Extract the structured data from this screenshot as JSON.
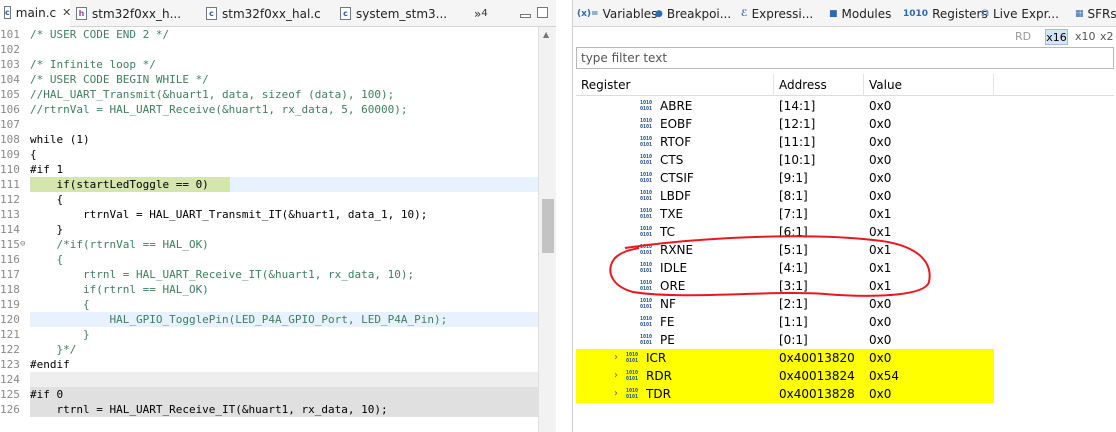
{
  "editor": {
    "tabs": [
      {
        "label": "main.c",
        "close": "✕"
      },
      {
        "label": "stm32f0xx_h..."
      },
      {
        "label": "stm32f0xx_hal.c"
      },
      {
        "label": "system_stm3..."
      }
    ],
    "overflow_label": "»",
    "overflow_count": "4",
    "lines": [
      {
        "n": "101",
        "t": "/* USER CODE END 2 */",
        "c": true
      },
      {
        "n": "102",
        "t": ""
      },
      {
        "n": "103",
        "t": "/* Infinite loop */",
        "c": true
      },
      {
        "n": "104",
        "t": "/* USER CODE BEGIN WHILE */",
        "c": true
      },
      {
        "n": "105",
        "t": "//HAL_UART_Transmit(&huart1, data, sizeof (data), 100);",
        "c": true
      },
      {
        "n": "106",
        "t": "//rtrnVal = HAL_UART_Receive(&huart1, rx_data, 5, 60000);",
        "c": true
      },
      {
        "n": "107",
        "t": ""
      },
      {
        "n": "108",
        "t": "while (1)"
      },
      {
        "n": "109",
        "t": "{"
      },
      {
        "n": "110",
        "t": "#if 1"
      },
      {
        "n": "111",
        "t": "    if(startLedToggle == 0)"
      },
      {
        "n": "112",
        "t": "    {"
      },
      {
        "n": "113",
        "t": "        rtrnVal = HAL_UART_Transmit_IT(&huart1, data_1, 10);"
      },
      {
        "n": "114",
        "t": "    }"
      },
      {
        "n": "115",
        "t": "    /*if(rtrnVal == HAL_OK)",
        "c": true,
        "fold": "⊖"
      },
      {
        "n": "116",
        "t": "    {",
        "c": true
      },
      {
        "n": "117",
        "t": "        rtrnl = HAL_UART_Receive_IT(&huart1, rx_data, 10);",
        "c": true
      },
      {
        "n": "118",
        "t": "        if(rtrnl == HAL_OK)",
        "c": true
      },
      {
        "n": "119",
        "t": "        {",
        "c": true
      },
      {
        "n": "120",
        "t": "            HAL_GPIO_TogglePin(LED_P4A_GPIO_Port, LED_P4A_Pin);",
        "c": true
      },
      {
        "n": "121",
        "t": "        }",
        "c": true
      },
      {
        "n": "122",
        "t": "    }*/",
        "c": true
      },
      {
        "n": "123",
        "t": "#endif"
      },
      {
        "n": "124",
        "t": ""
      },
      {
        "n": "125",
        "t": "#if 0"
      },
      {
        "n": "126",
        "t": "    rtrnl = HAL_UART_Receive_IT(&huart1, rx_data, 10);"
      }
    ]
  },
  "panel": {
    "tabs": [
      {
        "icon": "(x)=",
        "label": "Variables"
      },
      {
        "icon": "●",
        "label": "Breakpoi..."
      },
      {
        "icon": "ℰ",
        "label": "Expressi..."
      },
      {
        "icon": "■",
        "label": "Modules"
      },
      {
        "icon": "1010",
        "label": "Registers"
      },
      {
        "icon": "☊",
        "label": "Live Expr..."
      },
      {
        "icon": "▦",
        "label": "SFRs"
      }
    ],
    "toolbar": {
      "rd": "RD",
      "x16": "x16",
      "x10": "x10",
      "x2": "x2"
    },
    "filter_placeholder": "type filter text",
    "columns": [
      "Register",
      "Address",
      "Value"
    ],
    "registers": [
      {
        "name": "ABRE",
        "addr": "[14:1]",
        "val": "0x0"
      },
      {
        "name": "EOBF",
        "addr": "[12:1]",
        "val": "0x0"
      },
      {
        "name": "RTOF",
        "addr": "[11:1]",
        "val": "0x0"
      },
      {
        "name": "CTS",
        "addr": "[10:1]",
        "val": "0x0"
      },
      {
        "name": "CTSIF",
        "addr": "[9:1]",
        "val": "0x0"
      },
      {
        "name": "LBDF",
        "addr": "[8:1]",
        "val": "0x0"
      },
      {
        "name": "TXE",
        "addr": "[7:1]",
        "val": "0x1"
      },
      {
        "name": "TC",
        "addr": "[6:1]",
        "val": "0x1"
      },
      {
        "name": "RXNE",
        "addr": "[5:1]",
        "val": "0x1"
      },
      {
        "name": "IDLE",
        "addr": "[4:1]",
        "val": "0x1"
      },
      {
        "name": "ORE",
        "addr": "[3:1]",
        "val": "0x1"
      },
      {
        "name": "NF",
        "addr": "[2:1]",
        "val": "0x0"
      },
      {
        "name": "FE",
        "addr": "[1:1]",
        "val": "0x0"
      },
      {
        "name": "PE",
        "addr": "[0:1]",
        "val": "0x0"
      },
      {
        "name": "ICR",
        "addr": "0x40013820",
        "val": "0x0",
        "group": true
      },
      {
        "name": "RDR",
        "addr": "0x40013824",
        "val": "0x54",
        "group": true
      },
      {
        "name": "TDR",
        "addr": "0x40013828",
        "val": "0x0",
        "group": true
      }
    ],
    "highlight_color": "#ffff00",
    "annotation_color": "#e8191e"
  }
}
